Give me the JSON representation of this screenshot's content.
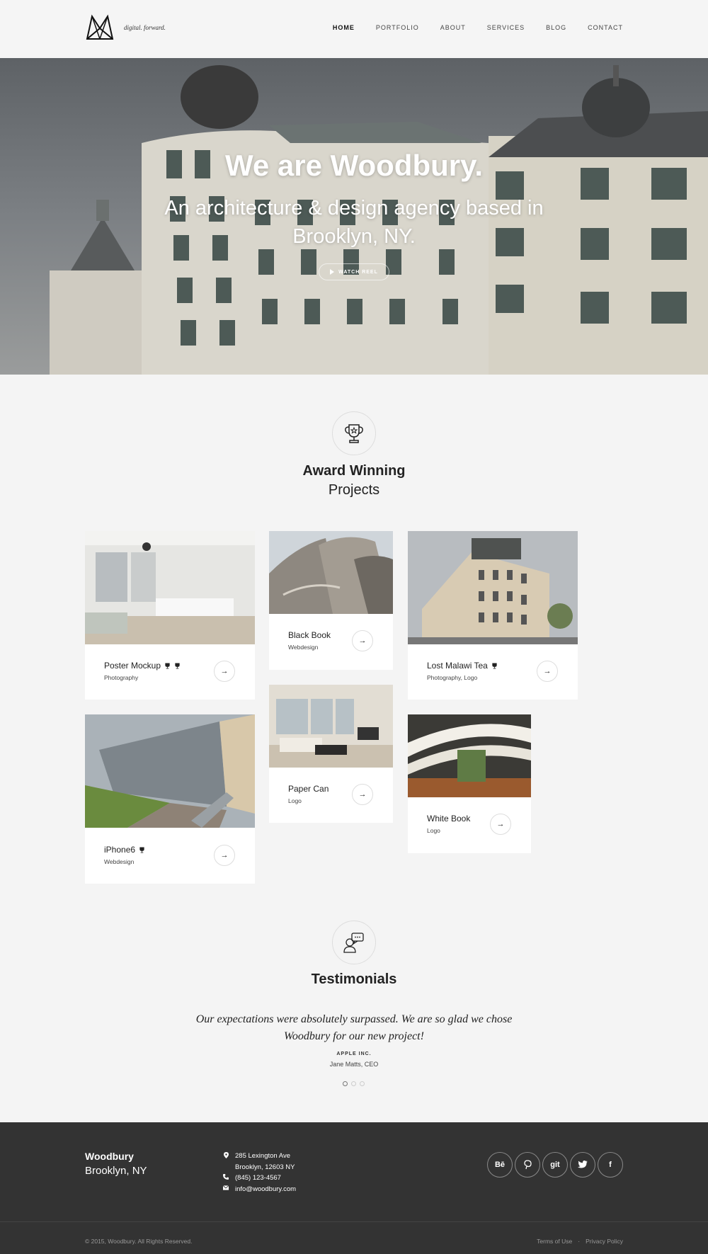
{
  "header": {
    "tagline": "digital. forward.",
    "nav": [
      "HOME",
      "PORTFOLIO",
      "ABOUT",
      "SERVICES",
      "BLOG",
      "CONTACT"
    ]
  },
  "hero": {
    "title": "We are Woodbury.",
    "subtitle": "An architecture & design agency based in Brooklyn, NY.",
    "button": "WATCH REEL"
  },
  "awards": {
    "title_line1": "Award Winning",
    "title_line2": "Projects",
    "icon": "trophy-icon"
  },
  "projects": [
    {
      "title": "Poster Mockup",
      "category": "Photography",
      "awards": 2
    },
    {
      "title": "Black Book",
      "category": "Webdesign",
      "awards": 0
    },
    {
      "title": "Lost Malawi Tea",
      "category": "Photography, Logo",
      "awards": 1
    },
    {
      "title": "iPhone6",
      "category": "Webdesign",
      "awards": 1
    },
    {
      "title": "Paper Can",
      "category": "Logo",
      "awards": 0
    },
    {
      "title": "White Book",
      "category": "Logo",
      "awards": 0
    }
  ],
  "testimonials": {
    "title": "Testimonials",
    "icon": "chat-user-icon",
    "quote": "Our expectations were absolutely surpassed. We are so glad we chose Woodbury for our new project!",
    "company": "APPLE INC.",
    "person": "Jane Matts, CEO",
    "dots": 3,
    "active_dot": 1
  },
  "footer": {
    "name": "Woodbury",
    "city": "Brooklyn, NY",
    "address1": "285 Lexington Ave",
    "address2": "Brooklyn, 12603 NY",
    "phone": "(845) 123-4567",
    "email": "info@woodbury.com",
    "social": [
      "Bē",
      "P",
      "git",
      "twitter",
      "f"
    ],
    "copyright": "© 2015, Woodbury. All Rights Reserved.",
    "terms": "Terms of Use",
    "separator": "·",
    "privacy": "Privacy Policy"
  }
}
